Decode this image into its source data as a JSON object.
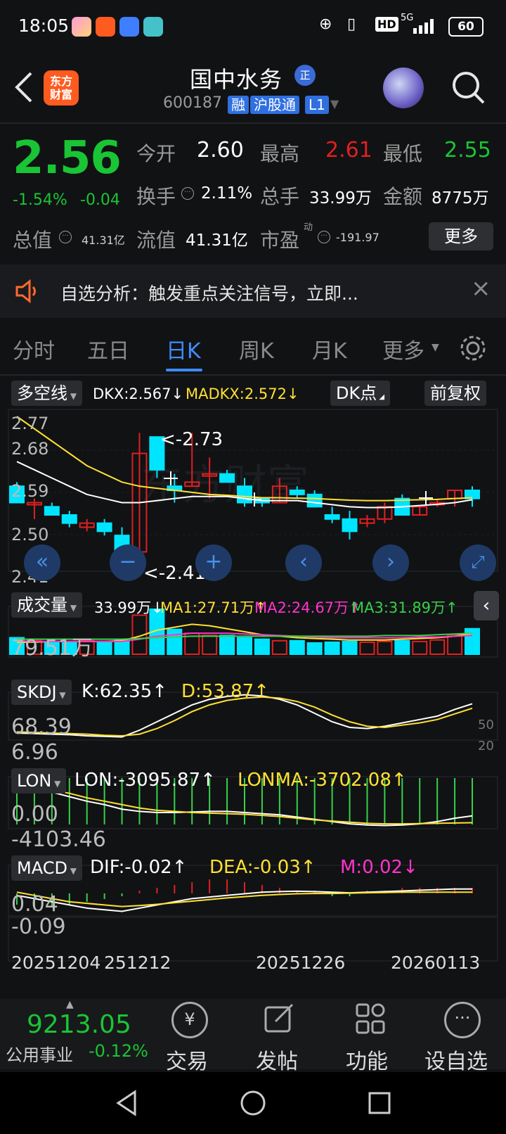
{
  "status": {
    "time": "18:05",
    "network": "5G",
    "battery": "60",
    "hd": "HD"
  },
  "header": {
    "title": "国中水务",
    "badge": "正",
    "code": "600187",
    "tags": [
      "融",
      "沪股通",
      "L1"
    ],
    "logo_line1": "东方",
    "logo_line2": "财富"
  },
  "quote": {
    "price": "2.56",
    "pct": "-1.54%",
    "chg": "-0.04",
    "open_label": "今开",
    "open": "2.60",
    "high_label": "最高",
    "high": "2.61",
    "low_label": "最低",
    "low": "2.55",
    "turnover_label": "换手",
    "turnover": "2.11%",
    "volume_label": "总手",
    "volume": "33.99万",
    "amount_label": "金额",
    "amount": "8775万",
    "mcap_label": "总值",
    "mcap": "41.31亿",
    "float_label": "流值",
    "float": "41.31亿",
    "pe_label": "市盈",
    "pe_sup": "动",
    "pe": "-191.97",
    "more": "更多"
  },
  "notice": {
    "text": "自选分析：触发重点关注信号，立即..."
  },
  "tabs": [
    "分时",
    "五日",
    "日K",
    "周K",
    "月K",
    "更多"
  ],
  "main_indicator": {
    "name": "多空线",
    "dkx": "DKX:2.567↓",
    "madkx": "MADKX:2.572↓",
    "dk_btn": "DK点",
    "fq_btn": "前复权"
  },
  "price_axis": [
    "2.77",
    "2.68",
    "2.59",
    "2.50",
    "2.41"
  ],
  "annotations": {
    "high": "<-2.73",
    "low": "<-2.41"
  },
  "volume_indicator": {
    "name": "成交量",
    "vol": "33.99万↓",
    "ma1": "MA1:27.71万↑",
    "ma2": "MA2:24.67万↑",
    "ma3": "MA3:31.89万↑",
    "axis": "79.51万"
  },
  "skdj": {
    "name": "SKDJ",
    "k": "K:62.35↑",
    "d": "D:53.87↑",
    "axis_top": "68.39",
    "axis_bottom": "6.96",
    "ref50": "50",
    "ref20": "20"
  },
  "lon": {
    "name": "LON",
    "lon": "LON:-3095.87↑",
    "lonma": "LONMA:-3702.08↑",
    "axis_top": "0.00",
    "axis_bottom": "-4103.46"
  },
  "macd": {
    "name": "MACD",
    "dif": "DIF:-0.02↑",
    "dea": "DEA:-0.03↑",
    "m": "M:0.02↓",
    "axis_top": "0.04",
    "axis_bottom": "-0.09"
  },
  "dates": [
    "20251204",
    "251212",
    "20251226",
    "20260113"
  ],
  "bottom": {
    "index_value": "9213.05",
    "index_name": "公用事业",
    "index_pct": "-0.12%",
    "trade": "交易",
    "post": "发帖",
    "func": "功能",
    "watch": "设自选"
  },
  "colors": {
    "up": "#e02020",
    "down": "#19c535",
    "cyan": "#00e5ff",
    "yellow": "#ffe033",
    "magenta": "#ff33cc",
    "green": "#36d14a",
    "blue": "#3f8cff"
  },
  "chart_data": {
    "type": "candlestick",
    "x": [
      "1",
      "2",
      "3",
      "4",
      "5",
      "6",
      "7",
      "8",
      "9",
      "10",
      "11",
      "12",
      "13",
      "14",
      "15",
      "16",
      "17",
      "18",
      "19",
      "20",
      "21",
      "22",
      "23",
      "24",
      "25",
      "26",
      "27"
    ],
    "ohlc": [
      [
        2.6,
        2.61,
        2.56,
        2.56
      ],
      [
        2.56,
        2.57,
        2.52,
        2.56
      ],
      [
        2.55,
        2.56,
        2.53,
        2.53
      ],
      [
        2.53,
        2.54,
        2.5,
        2.51
      ],
      [
        2.5,
        2.52,
        2.49,
        2.51
      ],
      [
        2.51,
        2.52,
        2.48,
        2.49
      ],
      [
        2.48,
        2.5,
        2.43,
        2.44
      ],
      [
        2.44,
        2.73,
        2.41,
        2.68
      ],
      [
        2.72,
        2.72,
        2.62,
        2.64
      ],
      [
        2.6,
        2.63,
        2.56,
        2.59
      ],
      [
        2.6,
        2.73,
        2.6,
        2.61
      ],
      [
        2.63,
        2.67,
        2.57,
        2.63
      ],
      [
        2.63,
        2.64,
        2.61,
        2.61
      ],
      [
        2.6,
        2.62,
        2.55,
        2.56
      ],
      [
        2.57,
        2.57,
        2.55,
        2.56
      ],
      [
        2.56,
        2.62,
        2.56,
        2.6
      ],
      [
        2.59,
        2.6,
        2.57,
        2.58
      ],
      [
        2.58,
        2.59,
        2.55,
        2.55
      ],
      [
        2.53,
        2.55,
        2.51,
        2.52
      ],
      [
        2.52,
        2.54,
        2.47,
        2.49
      ],
      [
        2.51,
        2.53,
        2.5,
        2.52
      ],
      [
        2.52,
        2.56,
        2.51,
        2.55
      ],
      [
        2.57,
        2.58,
        2.53,
        2.53
      ],
      [
        2.53,
        2.55,
        2.53,
        2.55
      ],
      [
        2.56,
        2.57,
        2.55,
        2.56
      ],
      [
        2.57,
        2.59,
        2.55,
        2.59
      ],
      [
        2.59,
        2.6,
        2.55,
        2.57
      ]
    ],
    "volume": [
      22,
      18,
      17,
      16,
      18,
      17,
      19,
      52,
      60,
      33,
      28,
      25,
      25,
      22,
      20,
      18,
      18,
      15,
      16,
      17,
      16,
      17,
      18,
      17,
      19,
      26,
      34
    ],
    "ylim": [
      2.41,
      2.77
    ]
  }
}
